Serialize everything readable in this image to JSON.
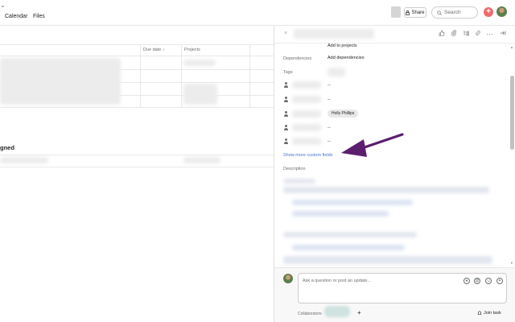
{
  "nav": {
    "tabs": [
      "Calendar",
      "Files"
    ]
  },
  "topbar": {
    "share_label": "Share",
    "search_placeholder": "Search",
    "plus_label": "+"
  },
  "list": {
    "columns": {
      "due_date": "Due date ↓",
      "projects": "Projects"
    },
    "section_title": "gned"
  },
  "panel": {
    "close": "×",
    "fields": {
      "add_to_projects": "Add to projects",
      "dependencies_label": "Dependencies",
      "add_dependencies": "Add dependencies",
      "tags_label": "Tags",
      "person_rows": [
        "--",
        "--",
        "Holly Phillips",
        "--",
        "--"
      ]
    },
    "show_more": "Show more custom fields",
    "description_label": "Description"
  },
  "composer": {
    "placeholder": "Ask a question or post an update...",
    "collaborators_label": "Collaborators",
    "add_collaborator": "+",
    "join_task": "Join task"
  },
  "colors": {
    "accent_red": "#f06a6a",
    "link_blue": "#4573d2",
    "arrow_purple": "#5b1f6e"
  }
}
